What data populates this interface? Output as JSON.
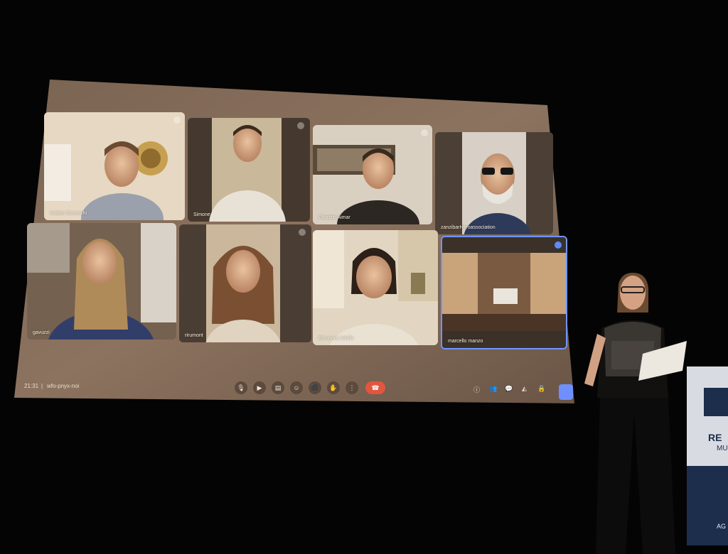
{
  "meeting": {
    "time": "21:31",
    "separator": "|",
    "code": "wfo-pnyx-noi"
  },
  "participants": [
    {
      "name": "Matteo Devecchi"
    },
    {
      "name": "Simone"
    },
    {
      "name": "Fabrizio Aimar"
    },
    {
      "name": "zanzibarHeroassociation"
    },
    {
      "name": "gavuzzi"
    },
    {
      "name": "rirumont"
    },
    {
      "name": "Eleonora Adolfo"
    },
    {
      "name": "marcello manzo"
    }
  ],
  "controls": {
    "mic_icon": "mic-icon",
    "camera_icon": "camera-icon",
    "captions_icon": "captions-icon",
    "emoji_icon": "emoji-icon",
    "present_icon": "present-icon",
    "raise_hand_icon": "raise-hand-icon",
    "more_icon": "more-options-icon",
    "hangup_icon": "hangup-icon"
  },
  "banner": {
    "text_line1": "RE",
    "text_line2": "MU",
    "text_line3": "AG"
  },
  "colors": {
    "screen": "#bfa688",
    "stage": "#050404",
    "hangup": "#e2563f",
    "active_border": "#6f95ff"
  }
}
